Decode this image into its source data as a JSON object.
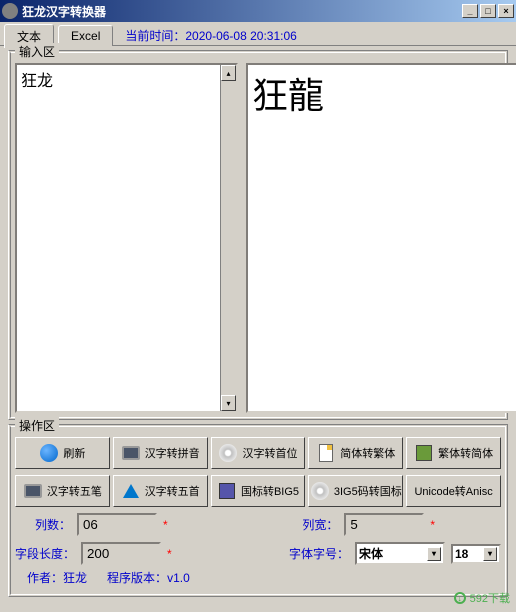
{
  "titlebar": {
    "title": "狂龙汉字转换器"
  },
  "tabs": {
    "text": "文本",
    "excel": "Excel"
  },
  "timestamp": {
    "label": "当前时间：",
    "value": "2020-06-08  20:31:06"
  },
  "input_section": {
    "legend": "输入区",
    "input_text": "狂龙",
    "output_text": "狂龍"
  },
  "action_section": {
    "legend": "操作区",
    "row1": {
      "refresh": "刷新",
      "hanzi_pinyin": "汉字转拼音",
      "hanzi_shouwei": "汉字转首位",
      "simp_to_trad": "简体转繁体",
      "trad_to_simp": "繁体转简体"
    },
    "row2": {
      "hanzi_wubi": "汉字转五笔",
      "hanzi_wushou": "汉字转五首",
      "guobiao_big5": "国标转BIG5",
      "big5_guobiao": "3IG5码转国标",
      "unicode_anisc": "Unicode转Anisc"
    }
  },
  "fields": {
    "lieshu_label": "列数：",
    "lieshu_value": "06",
    "liekuan_label": "列宽：",
    "liekuan_value": "5",
    "ziduan_label": "字段长度：",
    "ziduan_value": "200",
    "ziti_label": "字体字号：",
    "font_name": "宋体",
    "font_size": "18"
  },
  "footer": {
    "author_label": "作者：",
    "author": "狂龙",
    "version_label": "程序版本：",
    "version": "v1.0"
  },
  "watermark": "592下载"
}
